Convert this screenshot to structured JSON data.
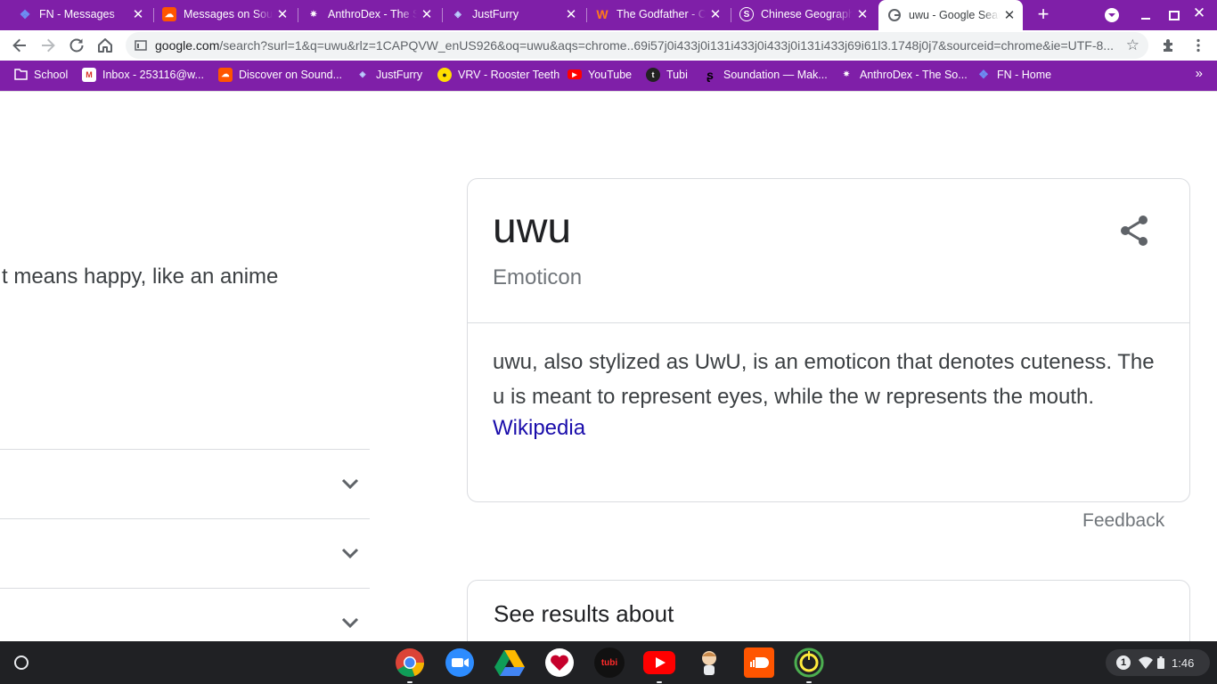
{
  "tabs": [
    {
      "title": "FN - Messages",
      "icon": "paw-icon",
      "active": false
    },
    {
      "title": "Messages on SoundCloud",
      "icon": "soundcloud-icon",
      "active": false
    },
    {
      "title": "AnthroDex - The Sona",
      "icon": "anthrodex-icon",
      "active": false
    },
    {
      "title": "JustFurry",
      "icon": "justfurry-icon",
      "active": false
    },
    {
      "title": "The Godfather - Chess",
      "icon": "wattpad-icon",
      "active": false
    },
    {
      "title": "Chinese Geography",
      "icon": "s-icon",
      "active": false
    },
    {
      "title": "uwu - Google Search",
      "icon": "google-icon",
      "active": true
    }
  ],
  "toolbar": {
    "url_host": "google.com",
    "url_path": "/search?surl=1&q=uwu&rlz=1CAPQVW_enUS926&oq=uwu&aqs=chrome..69i57j0i433j0i131i433j0i433j0i131i433j69i61l3.1748j0j7&sourceid=chrome&ie=UTF-8..."
  },
  "bookmarks": [
    {
      "label": "School",
      "icon": "folder-icon"
    },
    {
      "label": "Inbox - 253116@w...",
      "icon": "gmail-icon"
    },
    {
      "label": "Discover on Sound...",
      "icon": "soundcloud-icon"
    },
    {
      "label": "JustFurry",
      "icon": "justfurry-icon"
    },
    {
      "label": "VRV - Rooster Teeth",
      "icon": "vrv-icon"
    },
    {
      "label": "YouTube",
      "icon": "youtube-icon"
    },
    {
      "label": "Tubi",
      "icon": "tubi-icon"
    },
    {
      "label": "Soundation — Mak...",
      "icon": "soundation-icon"
    },
    {
      "label": "AnthroDex - The So...",
      "icon": "anthrodex-icon"
    },
    {
      "label": "FN - Home",
      "icon": "paw-icon"
    }
  ],
  "results": {
    "snippet": "t means happy, like an anime"
  },
  "knowledge_panel": {
    "title": "uwu",
    "subtitle": "Emoticon",
    "description": "uwu, also stylized as UwU, is an emoticon that denotes cuteness. The u is meant to represent eyes, while the w represents the mouth.",
    "source_link": "Wikipedia"
  },
  "feedback_label": "Feedback",
  "see_results": {
    "title": "See results about"
  },
  "shelf": {
    "apps": [
      "chrome-icon",
      "zoom-icon",
      "google-drive-icon",
      "iheartradio-icon",
      "tubi-icon",
      "youtube-icon",
      "character-app-icon",
      "soundcloud-icon",
      "timer-app-icon"
    ],
    "tubi_text": "tubi",
    "notification_count": "1",
    "time": "1:46"
  },
  "colors": {
    "accent": "#7f1fa8",
    "link": "#1a0dab",
    "shelf": "#202124"
  }
}
